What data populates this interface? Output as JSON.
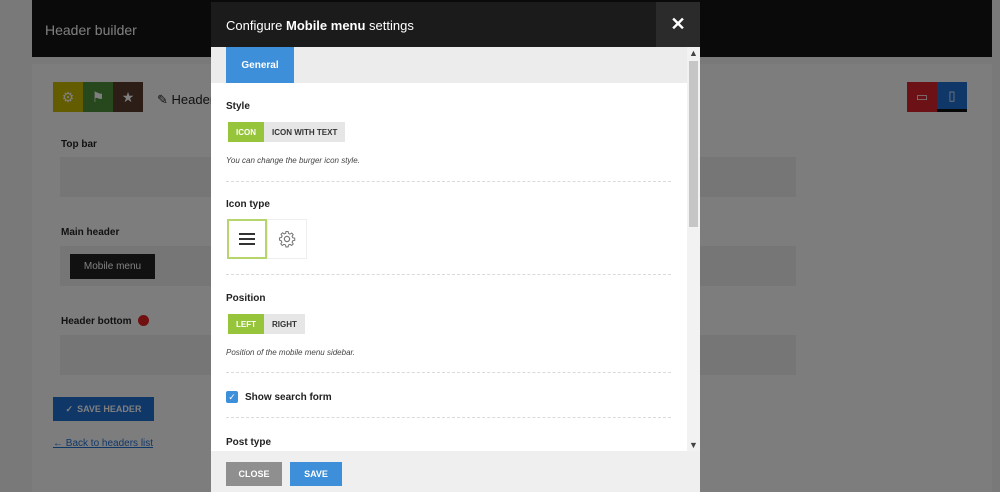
{
  "background": {
    "header_title": "Header builder",
    "edit_label": "Header",
    "rows": [
      "Top bar",
      "Main header",
      "Header bottom"
    ],
    "element_chip": "Mobile menu",
    "save_label": "SAVE HEADER",
    "back_link": "← Back to headers list"
  },
  "modal": {
    "title_prefix": "Configure ",
    "title_bold": "Mobile menu",
    "title_suffix": " settings",
    "close_symbol": "✕",
    "tabs": [
      {
        "label": "General"
      }
    ],
    "style": {
      "label": "Style",
      "options": [
        "ICON",
        "ICON WITH TEXT"
      ],
      "selected": "ICON",
      "hint": "You can change the burger icon style."
    },
    "icon_type": {
      "label": "Icon type",
      "options": [
        "menu-icon",
        "gear-icon"
      ],
      "selected": "menu-icon"
    },
    "position": {
      "label": "Position",
      "options": [
        "LEFT",
        "RIGHT"
      ],
      "selected": "LEFT",
      "hint": "Position of the mobile menu sidebar."
    },
    "show_search": {
      "label": "Show search form",
      "checked": true
    },
    "post_type": {
      "label": "Post type"
    },
    "footer": {
      "close_label": "CLOSE",
      "save_label": "SAVE"
    }
  },
  "colors": {
    "accent_blue": "#3d8fd9",
    "accent_green": "#96c43b",
    "header_dark": "#1b1b1b"
  }
}
